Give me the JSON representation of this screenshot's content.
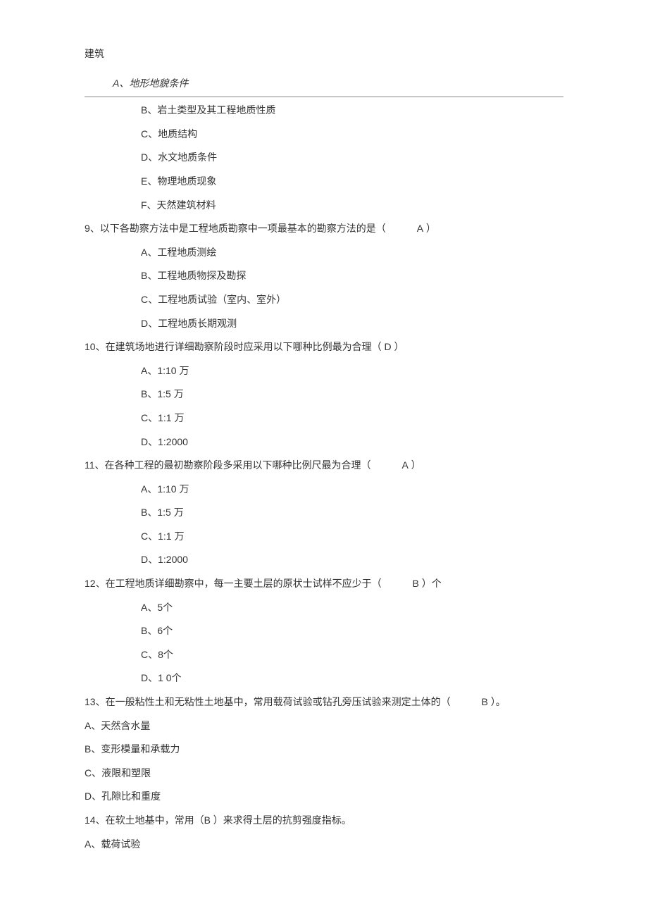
{
  "header": "建筑",
  "q8_options": {
    "A": "A、地形地貌条件",
    "B": "B、岩土类型及其工程地质性质",
    "C": "C、地质结构",
    "D": "D、水文地质条件",
    "E": "E、物理地质现象",
    "F": "F、天然建筑材料"
  },
  "q9": {
    "text_before": "9、以下各勘察方法中是工程地质勘察中一项最基本的勘察方法的是（",
    "answer": "A",
    "text_after": "）",
    "options": {
      "A": "A、工程地质测绘",
      "B": "B、工程地质物探及勘探",
      "C": "C、工程地质试验（室内、室外）",
      "D": "D、工程地质长期观测"
    }
  },
  "q10": {
    "text": "10、在建筑场地进行详细勘察阶段时应采用以下哪种比例最为合理（ D ）",
    "options": {
      "A": "A、1:10 万",
      "B": "B、1:5 万",
      "C": "C、1:1 万",
      "D": "D、1:2000"
    }
  },
  "q11": {
    "text_before": "11、在各种工程的最初勘察阶段多采用以下哪种比例尺最为合理（",
    "answer": "A",
    "text_after": "）",
    "options": {
      "A": "A、1:10 万",
      "B": "B、1:5 万",
      "C": "C、1:1 万",
      "D": "D、1:2000"
    }
  },
  "q12": {
    "text_before": "12、在工程地质详细勘察中，每一主要土层的原状士试样不应少于（",
    "answer": "B",
    "text_after": "）个",
    "options": {
      "A": "A、5个",
      "B": "B、6个",
      "C": "C、8个",
      "D": "D、1 0个"
    }
  },
  "q13": {
    "text_before": "13、在一般粘性土和无粘性土地基中，常用载荷试验或钻孔旁压试验来测定土体的（",
    "answer": "B",
    "text_after": "）。",
    "options": {
      "A": "A、天然含水量",
      "B": "B、变形模量和承载力",
      "C": "C、液限和塑限",
      "D": "D、孔隙比和重度"
    }
  },
  "q14": {
    "text": "14、在软土地基中，常用（B ）来求得土层的抗剪强度指标。",
    "options": {
      "A": "A、载荷试验"
    }
  }
}
